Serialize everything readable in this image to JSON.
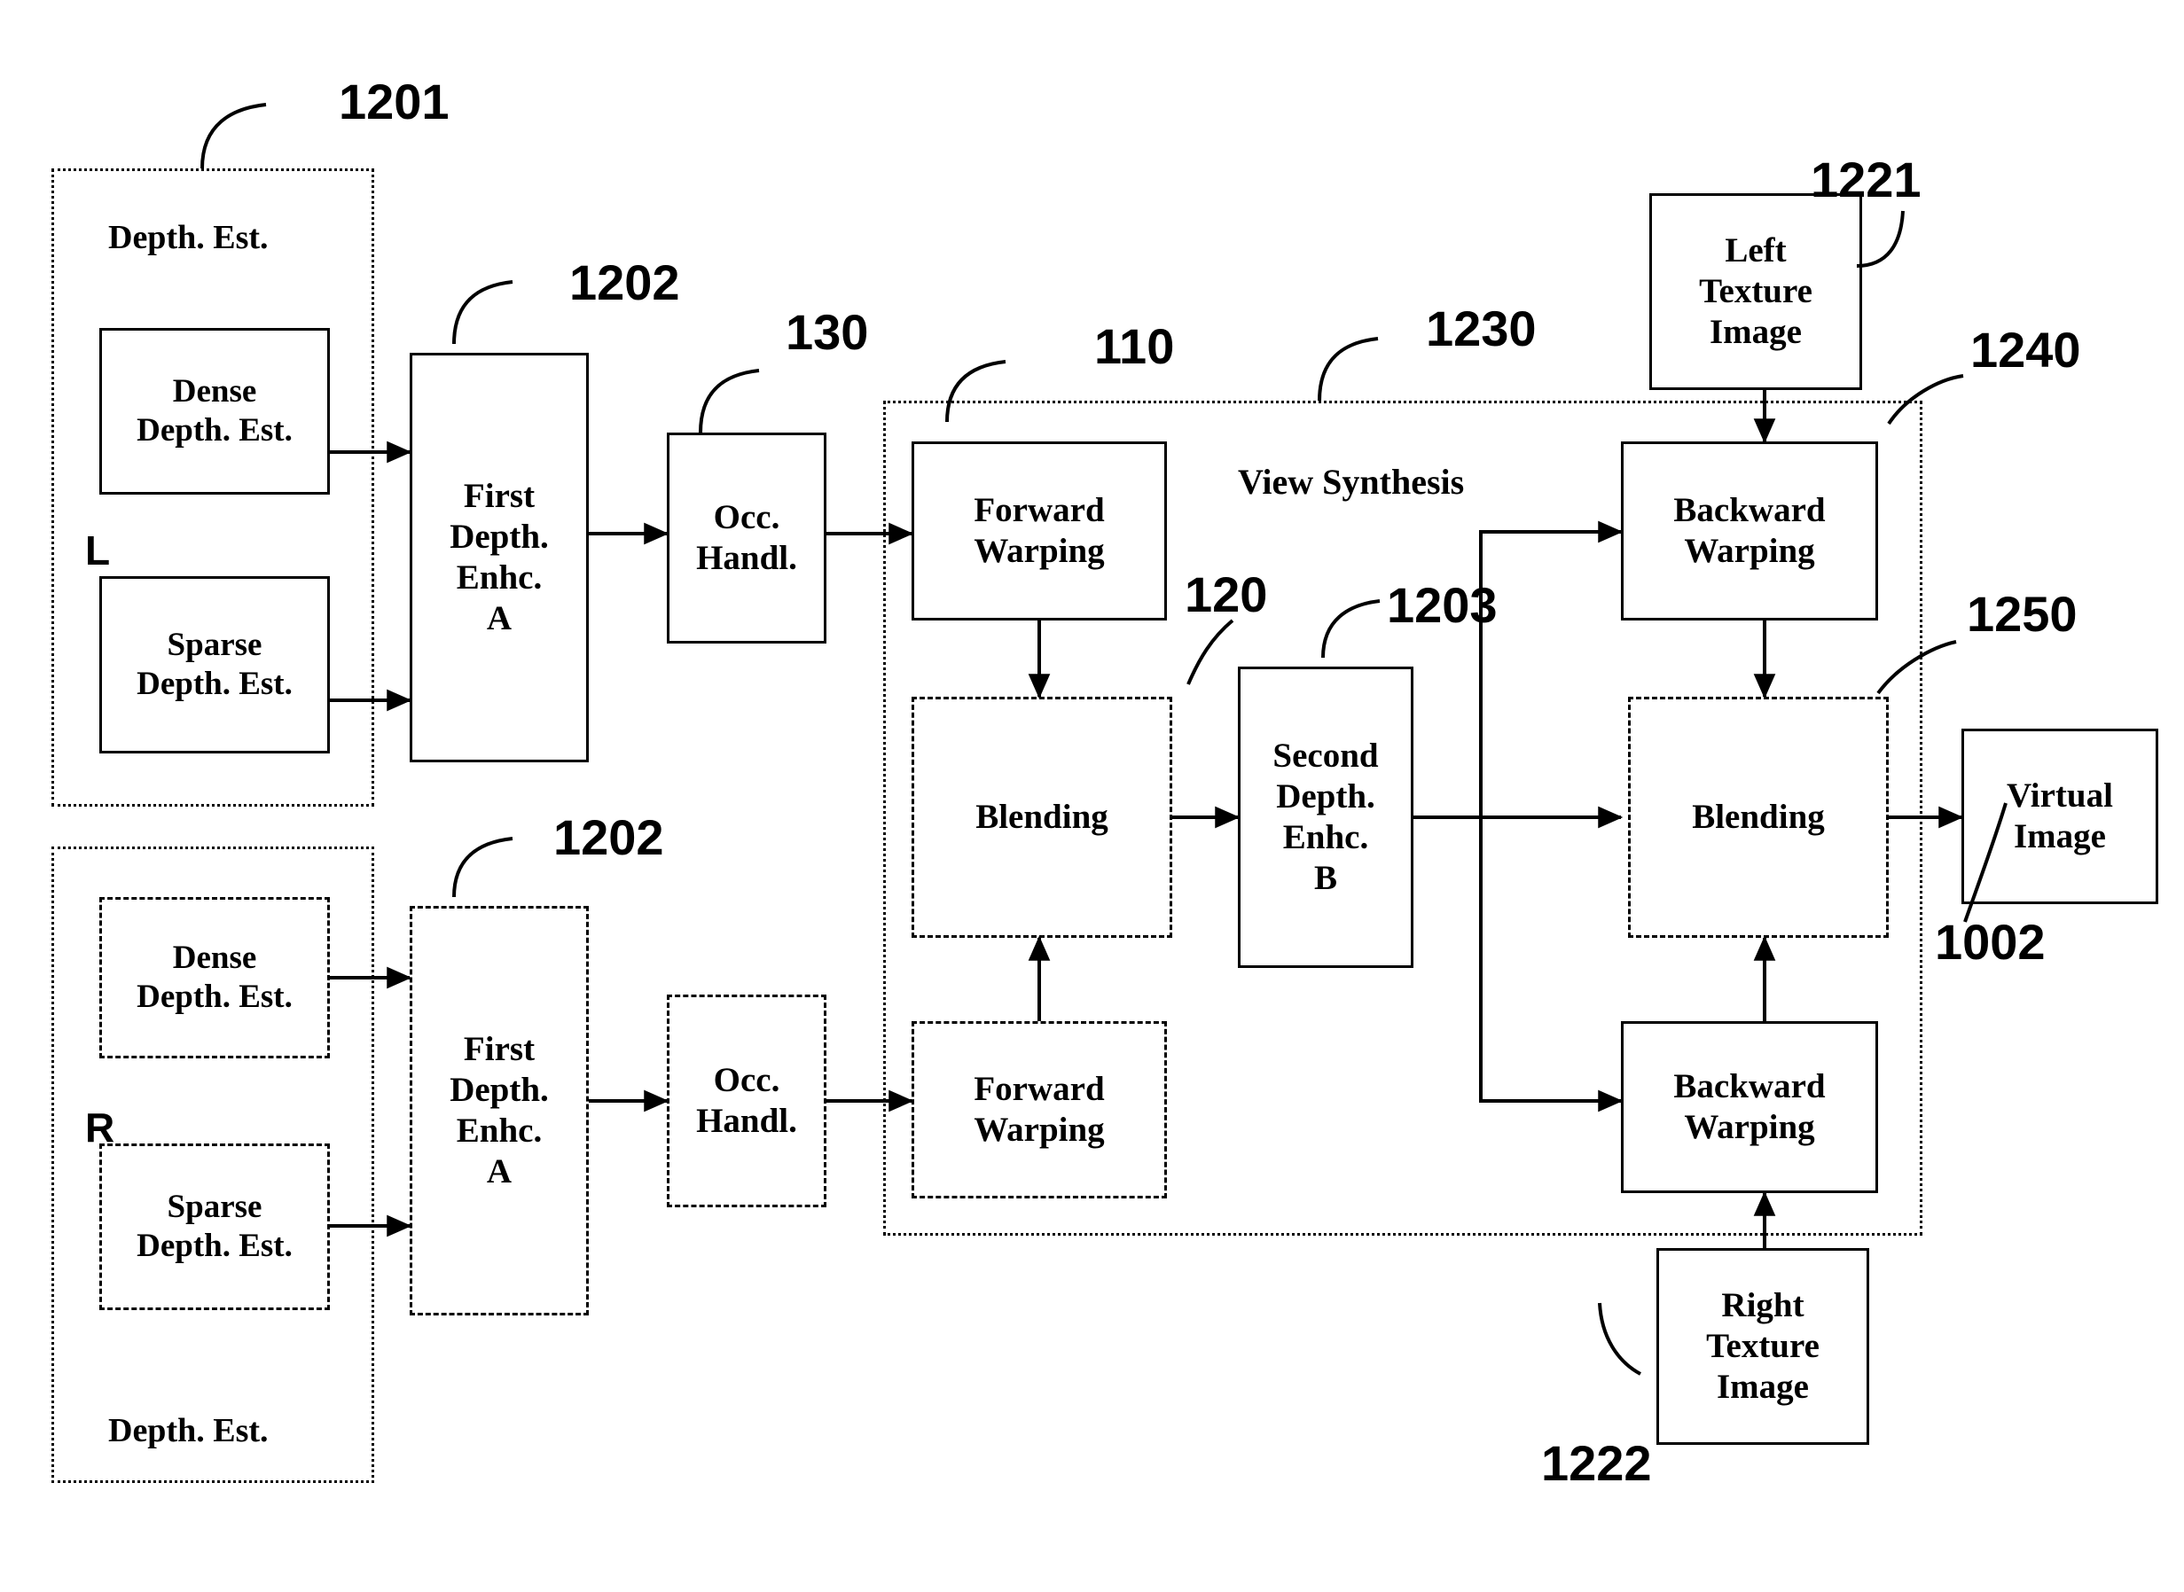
{
  "figure": {
    "title": "View Synthesis Pipeline Block Diagram",
    "stroke_color": "#000000",
    "background_color": "#ffffff"
  },
  "groups": {
    "left_depth_est": {
      "label": "Depth. Est.",
      "ref": "1201",
      "side_marker": "L",
      "border": "dotted"
    },
    "right_depth_est": {
      "label": "Depth. Est.",
      "ref": "",
      "side_marker": "R",
      "border": "dotted"
    },
    "view_synthesis": {
      "label": "View Synthesis",
      "ref": "1230",
      "border": "dotted"
    }
  },
  "blocks": {
    "dense_depth_est_left": {
      "label": "Dense\nDepth. Est.",
      "border": "solid"
    },
    "sparse_depth_est_left": {
      "label": "Sparse\nDepth. Est.",
      "border": "solid"
    },
    "dense_depth_est_right": {
      "label": "Dense\nDepth. Est.",
      "border": "dashed"
    },
    "sparse_depth_est_right": {
      "label": "Sparse\nDepth. Est.",
      "border": "dashed"
    },
    "first_depth_enhc_a_top": {
      "label": "First\nDepth.\nEnhc.\nA",
      "border": "solid",
      "ref": "1202"
    },
    "first_depth_enhc_a_bottom": {
      "label": "First\nDepth.\nEnhc.\nA",
      "border": "dashed",
      "ref": "1202"
    },
    "occ_handl_top": {
      "label": "Occ.\nHandl.",
      "border": "solid",
      "ref": "130"
    },
    "occ_handl_bottom": {
      "label": "Occ.\nHandl.",
      "border": "dashed"
    },
    "forward_warping_top": {
      "label": "Forward\nWarping",
      "border": "solid",
      "ref": "110"
    },
    "forward_warping_bottom": {
      "label": "Forward\nWarping",
      "border": "dashed"
    },
    "blending_left": {
      "label": "Blending",
      "border": "dashed",
      "ref": "120"
    },
    "second_depth_enhc_b": {
      "label": "Second\nDepth.\nEnhc.\nB",
      "border": "solid",
      "ref": "1203"
    },
    "backward_warping_top": {
      "label": "Backward\nWarping",
      "border": "solid",
      "ref": "1240"
    },
    "backward_warping_bottom": {
      "label": "Backward\nWarping",
      "border": "solid"
    },
    "blending_right": {
      "label": "Blending",
      "border": "dashed",
      "ref": "1250"
    },
    "left_texture_image": {
      "label": "Left\nTexture\nImage",
      "border": "solid",
      "ref": "1221"
    },
    "right_texture_image": {
      "label": "Right\nTexture\nImage",
      "border": "solid",
      "ref": "1222"
    },
    "virtual_image": {
      "label": "Virtual\nImage",
      "border": "solid",
      "ref": "1002"
    }
  },
  "reference_numerals": [
    {
      "id": "1201",
      "text": "1201"
    },
    {
      "id": "1202_top",
      "text": "1202"
    },
    {
      "id": "1202_bottom",
      "text": "1202"
    },
    {
      "id": "130",
      "text": "130"
    },
    {
      "id": "110",
      "text": "110"
    },
    {
      "id": "1230",
      "text": "1230"
    },
    {
      "id": "1221",
      "text": "1221"
    },
    {
      "id": "1240",
      "text": "1240"
    },
    {
      "id": "120",
      "text": "120"
    },
    {
      "id": "1203",
      "text": "1203"
    },
    {
      "id": "1250",
      "text": "1250"
    },
    {
      "id": "1002",
      "text": "1002"
    },
    {
      "id": "1222",
      "text": "1222"
    }
  ],
  "side_markers": {
    "left": "L",
    "right": "R"
  }
}
